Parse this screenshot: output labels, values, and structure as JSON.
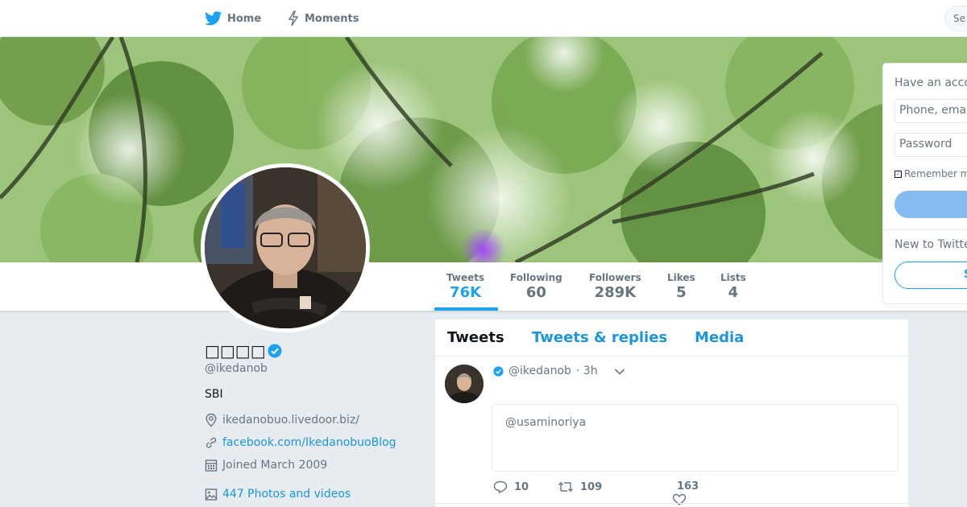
{
  "nav": {
    "home_label": "Home",
    "moments_label": "Moments",
    "search_placeholder": "Se"
  },
  "profile": {
    "name": "□□□□",
    "handle": "@ikedanob",
    "bio": "SBI",
    "location": "ikedanobuo.livedoor.biz/",
    "website": "facebook.com/IkedanobuoBlog",
    "joined": "Joined March 2009",
    "photos_videos": "447 Photos and videos",
    "verified": true
  },
  "stats": [
    {
      "label": "Tweets",
      "value": "76K"
    },
    {
      "label": "Following",
      "value": "60"
    },
    {
      "label": "Followers",
      "value": "289K"
    },
    {
      "label": "Likes",
      "value": "5"
    },
    {
      "label": "Lists",
      "value": "4"
    }
  ],
  "timeline": {
    "tabs": [
      "Tweets",
      "Tweets & replies",
      "Media"
    ],
    "tweet": {
      "handle": "@ikedanob",
      "time": "· 3h",
      "quoted_text": "@usaminoriya",
      "replies": "10",
      "retweets": "109",
      "likes": "163"
    }
  },
  "login": {
    "title": "Have an acco",
    "phone_placeholder": "Phone, emai",
    "password_placeholder": "Password",
    "remember": "Remember m",
    "new_to": "New to Twitte",
    "signup_partial": "S"
  },
  "colors": {
    "accent": "#1da1f2",
    "link": "#1b95e0",
    "muted": "#657786",
    "background": "#e6ecf0"
  }
}
